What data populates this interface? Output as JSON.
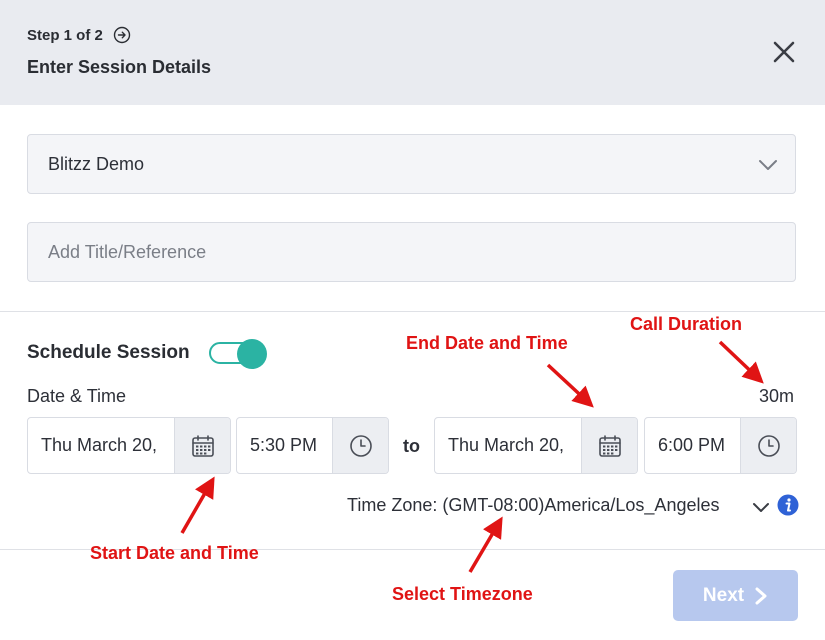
{
  "header": {
    "step": "Step 1 of 2",
    "title": "Enter Session Details"
  },
  "form": {
    "account_select": {
      "value": "Blitzz Demo"
    },
    "title_field": {
      "placeholder": "Add Title/Reference"
    }
  },
  "schedule": {
    "label": "Schedule Session",
    "toggle_on": true,
    "datetime_label": "Date & Time",
    "duration": "30m",
    "start_date": "Thu March 20,",
    "start_time": "5:30 PM",
    "to_label": "to",
    "end_date": "Thu March 20,",
    "end_time": "6:00 PM",
    "timezone": "Time Zone:  (GMT-08:00)America/Los_Angeles"
  },
  "footer": {
    "next_label": "Next"
  },
  "annotations": {
    "call_duration": "Call Duration",
    "end_date_time": "End Date and Time",
    "start_date_time": "Start Date and Time",
    "select_timezone": "Select Timezone"
  },
  "colors": {
    "header_bg": "#e9ebf0",
    "toggle_accent": "#2bb3a3",
    "next_button": "#b7c8ee",
    "info_icon": "#2f62d6",
    "annotation_red": "#e01414"
  },
  "icons": [
    "arrow-circle-right-icon",
    "close-icon",
    "chevron-down-icon",
    "calendar-icon",
    "clock-icon",
    "info-icon",
    "chevron-right-icon"
  ]
}
